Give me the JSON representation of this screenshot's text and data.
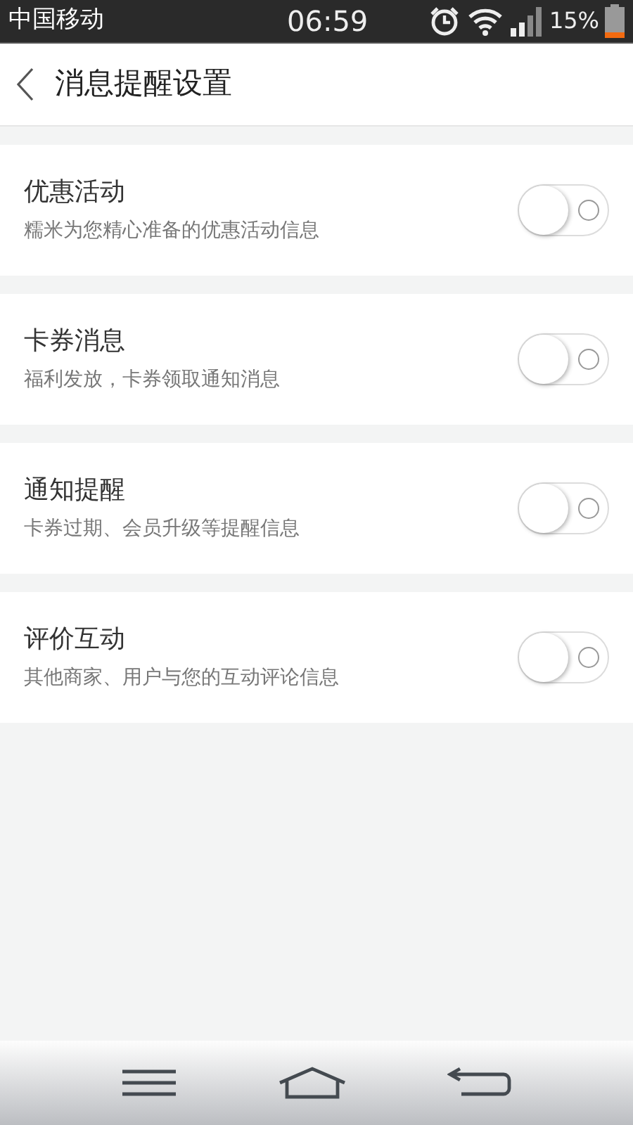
{
  "status_bar": {
    "carrier": "中国移动",
    "time": "06:59",
    "battery": "15%"
  },
  "header": {
    "title": "消息提醒设置"
  },
  "settings": [
    {
      "title": "优惠活动",
      "description": "糯米为您精心准备的优惠活动信息",
      "on": false
    },
    {
      "title": "卡券消息",
      "description": "福利发放，卡券领取通知消息",
      "on": false
    },
    {
      "title": "通知提醒",
      "description": "卡券过期、会员升级等提醒信息",
      "on": false
    },
    {
      "title": "评价互动",
      "description": "其他商家、用户与您的互动评论信息",
      "on": false
    }
  ]
}
